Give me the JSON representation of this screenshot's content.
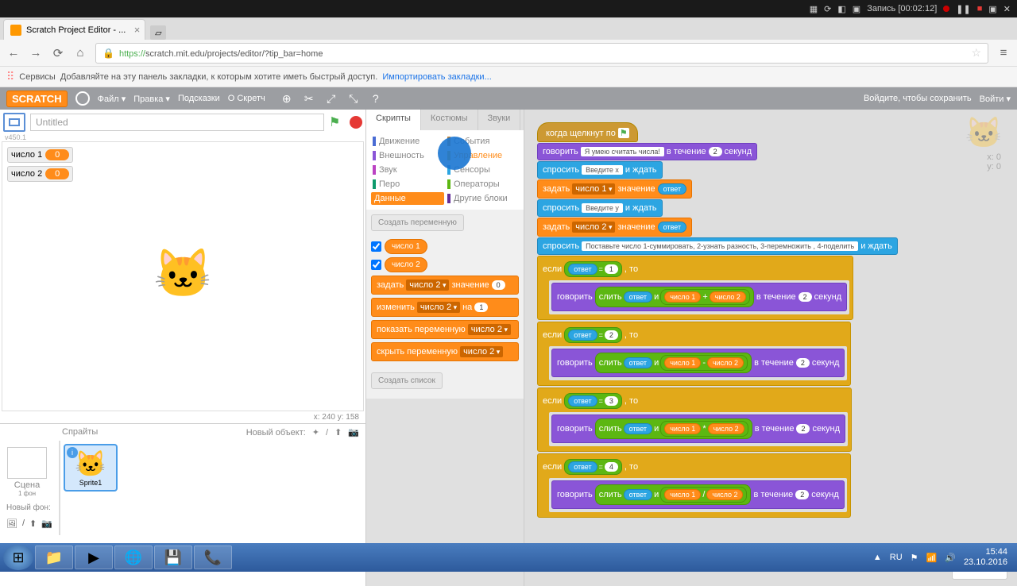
{
  "titlebar": {
    "record": "Запись [00:02:12]"
  },
  "browser": {
    "tab_title": "Scratch Project Editor - ...",
    "url_prefix": "https://",
    "url": "scratch.mit.edu/projects/editor/?tip_bar=home",
    "bookmarks_label": "Сервисы",
    "bookmarks_hint": "Добавляйте на эту панель закладки, к которым хотите иметь быстрый доступ.",
    "import_link": "Импортировать закладки..."
  },
  "header": {
    "logo": "SCRATCH",
    "file": "Файл ▾",
    "edit": "Правка ▾",
    "tips": "Подсказки",
    "about": "О Скретч",
    "save_prompt": "Войдите, чтобы сохранить",
    "signin": "Войти ▾"
  },
  "stage": {
    "title": "Untitled",
    "version": "v450.1",
    "var1_label": "число 1",
    "var1_val": "0",
    "var2_label": "число 2",
    "var2_val": "0",
    "coords": "x: 240  y: 158"
  },
  "sprites": {
    "title": "Спрайты",
    "new_obj": "Новый объект:",
    "stage_label": "Сцена",
    "stage_sub": "1 фон",
    "new_bg": "Новый фон:",
    "sprite1": "Sprite1"
  },
  "tabs": {
    "scripts": "Скрипты",
    "costumes": "Костюмы",
    "sounds": "Звуки"
  },
  "cats": {
    "motion": "Движение",
    "looks": "Внешность",
    "sound": "Звук",
    "pen": "Перо",
    "data": "Данные",
    "events": "События",
    "control": "Управление",
    "sensing": "Сенсоры",
    "operators": "Операторы",
    "more": "Другие блоки"
  },
  "palette": {
    "make_var": "Создать переменную",
    "make_list": "Создать список",
    "var1": "число 1",
    "var2": "число 2",
    "set": "задать",
    "val": "значение",
    "change": "изменить",
    "by": "на",
    "show": "показать переменную",
    "hide": "скрыть переменную"
  },
  "script": {
    "when_clicked": "когда щелкнут по",
    "say": "говорить",
    "say_msg1": "Я умею считать числа!",
    "for": "в течение",
    "secs": "секунд",
    "ask": "спросить",
    "wait": "и ждать",
    "enter_x": "Введите x",
    "enter_y": "Введите y",
    "long_q": "Поставьте число 1-суммировать, 2-узнать разность, 3-перемножить , 4-поделить",
    "set": "задать",
    "val": "значение",
    "answer": "ответ",
    "if": "если",
    "then": ", то",
    "join": "слить",
    "and": "и",
    "var1": "число 1",
    "var2": "число 2",
    "n1": "1",
    "n2": "2",
    "n3": "3",
    "n4": "4",
    "op_plus": "+",
    "op_minus": "-",
    "op_mul": "*",
    "op_div": "/"
  },
  "watermark": {
    "x": "x: 0",
    "y": "y: 0"
  },
  "taskbar": {
    "lang": "RU",
    "time": "15:44",
    "date": "23.10.2016"
  }
}
